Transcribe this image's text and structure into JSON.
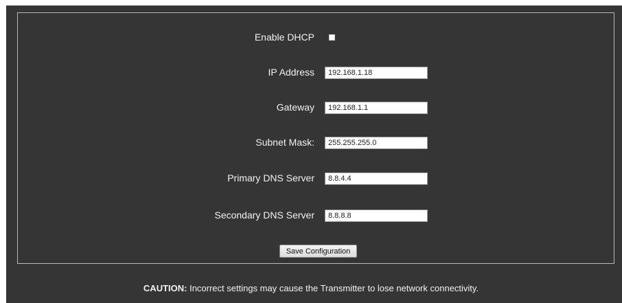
{
  "form": {
    "dhcp": {
      "label": "Enable DHCP",
      "checked": false
    },
    "ip_address": {
      "label": "IP Address",
      "value": "192.168.1.18"
    },
    "gateway": {
      "label": "Gateway",
      "value": "192.168.1.1"
    },
    "subnet_mask": {
      "label": "Subnet Mask:",
      "value": "255.255.255.0"
    },
    "primary_dns": {
      "label": "Primary DNS Server",
      "value": "8.8.4.4"
    },
    "secondary_dns": {
      "label": "Secondary DNS Server",
      "value": "8.8.8.8"
    },
    "save_label": "Save Configuration"
  },
  "caution": {
    "prefix": "CAUTION:",
    "text": " Incorrect settings may cause the Transmitter to lose network connectivity."
  },
  "colors": {
    "panel_bg": "#353535",
    "border": "#b9b9b9",
    "text": "#f2f2f2"
  }
}
